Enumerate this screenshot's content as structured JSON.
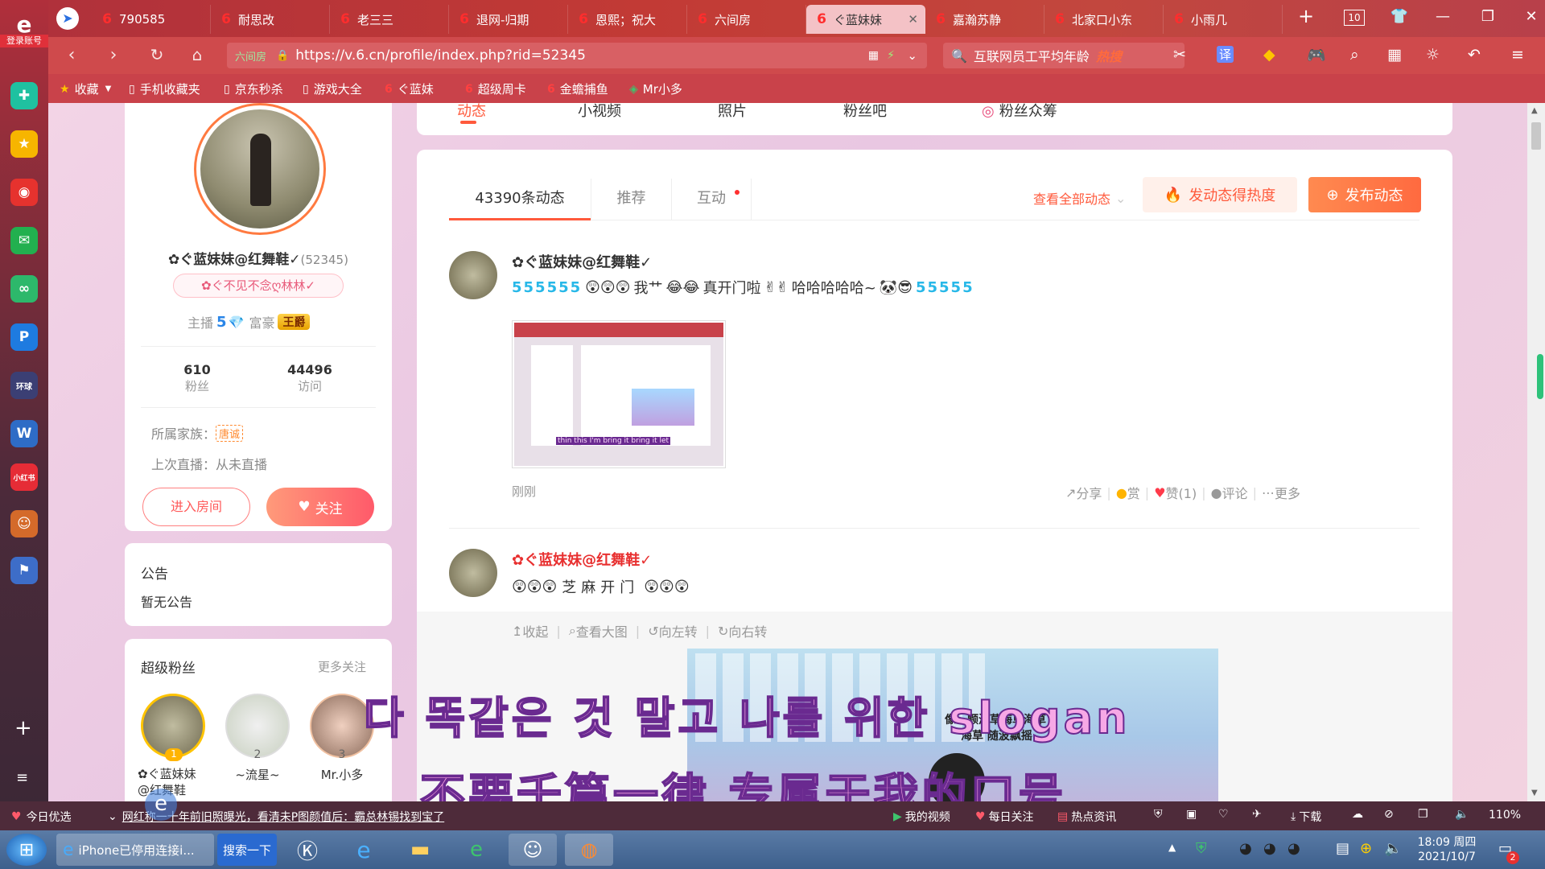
{
  "browser": {
    "left_top_label": "登录账号",
    "tabs": [
      {
        "label": "790585"
      },
      {
        "label": "耐思改"
      },
      {
        "label": "老三三"
      },
      {
        "label": "退网-归期"
      },
      {
        "label": "恩熙；祝大"
      },
      {
        "label": "六间房"
      },
      {
        "label": "ぐ蓝妹妹",
        "active": true
      },
      {
        "label": "嘉瀚苏静"
      },
      {
        "label": "北家口小东"
      },
      {
        "label": "小雨几"
      }
    ],
    "tab_count": "10",
    "url_prefix": "六间房",
    "url": "https://v.6.cn/profile/index.php?rid=52345",
    "search_text": "互联网员工平均年龄",
    "search_hot": "热搜",
    "translate_label": "译",
    "bookmarks": [
      "收藏",
      "手机收藏夹",
      "京东秒杀",
      "游戏大全",
      "ぐ蓝妹",
      "超级周卡",
      "金蟾捕鱼",
      "Mr小多"
    ]
  },
  "profile": {
    "top_nav": [
      "动态",
      "小视频",
      "照片",
      "粉丝吧",
      "粉丝众筹"
    ],
    "name": "✿ぐ蓝妹妹@红舞鞋✓",
    "rid": "(52345)",
    "tag": "✿ぐ不见不念ღ林林✓",
    "host_label": "主播",
    "host_level": "5",
    "rich_label": "富豪",
    "rich_badge": "王爵",
    "fans_count": "610",
    "fans_label": "粉丝",
    "visits_count": "44496",
    "visits_label": "访问",
    "family_label": "所属家族：",
    "family_badge": "唐诚",
    "last_live": "上次直播：从未直播",
    "enter_room": "进入房间",
    "follow": "关注",
    "notice_title": "公告",
    "notice_text": "暂无公告",
    "superfans_title": "超级粉丝",
    "superfans_more": "更多关注",
    "superfans": [
      {
        "rank": "1",
        "name": "✿ぐ蓝妹妹@红舞鞋"
      },
      {
        "rank": "2",
        "name": "~流星~"
      },
      {
        "rank": "3",
        "name": "Mr.小多"
      }
    ]
  },
  "feed": {
    "tabs": [
      "43390条动态",
      "推荐",
      "互动"
    ],
    "view_all": "查看全部动态",
    "hot_button": "发动态得热度",
    "post_button": "发布动态",
    "posts": [
      {
        "author": "✿ぐ蓝妹妹@红舞鞋✓",
        "text_mid": "我艹",
        "text_mid2": "真开门啦",
        "text_end": "哈哈哈哈哈~",
        "time": "刚刚",
        "thumb_caption": "thin this I'm bring it bring it let",
        "actions": [
          "分享",
          "赏",
          "赞(1)",
          "评论",
          "更多"
        ]
      },
      {
        "author": "✿ぐ蓝妹妹@红舞鞋✓",
        "text": "芝麻开门",
        "image_actions": [
          "收起",
          "查看大图",
          "向左转",
          "向右转"
        ],
        "image_caption_1": "像一颗海草海草海草",
        "image_caption_2": "海草 随波飘摇"
      }
    ]
  },
  "subtitles": {
    "korean": "다 똑같은 것 말고 나를 위한 slogan",
    "chinese": "不要千篇一律 专属于我的口号"
  },
  "statusbar": {
    "today": "今日优选",
    "news": "网红称一十年前旧照曝光，看清未P图颜值后：霸总林锡找到宝了",
    "items": [
      "我的视频",
      "每日关注",
      "热点资讯"
    ],
    "download": "下载",
    "zoom": "110%"
  },
  "taskbar": {
    "ie_window": "iPhone已停用连接i...",
    "search_btn": "搜索一下",
    "time": "18:09 周四",
    "date": "2021/10/7",
    "badge": "2"
  },
  "colors": {
    "accent": "#ff5a3c",
    "brand_red": "#e8323c"
  }
}
